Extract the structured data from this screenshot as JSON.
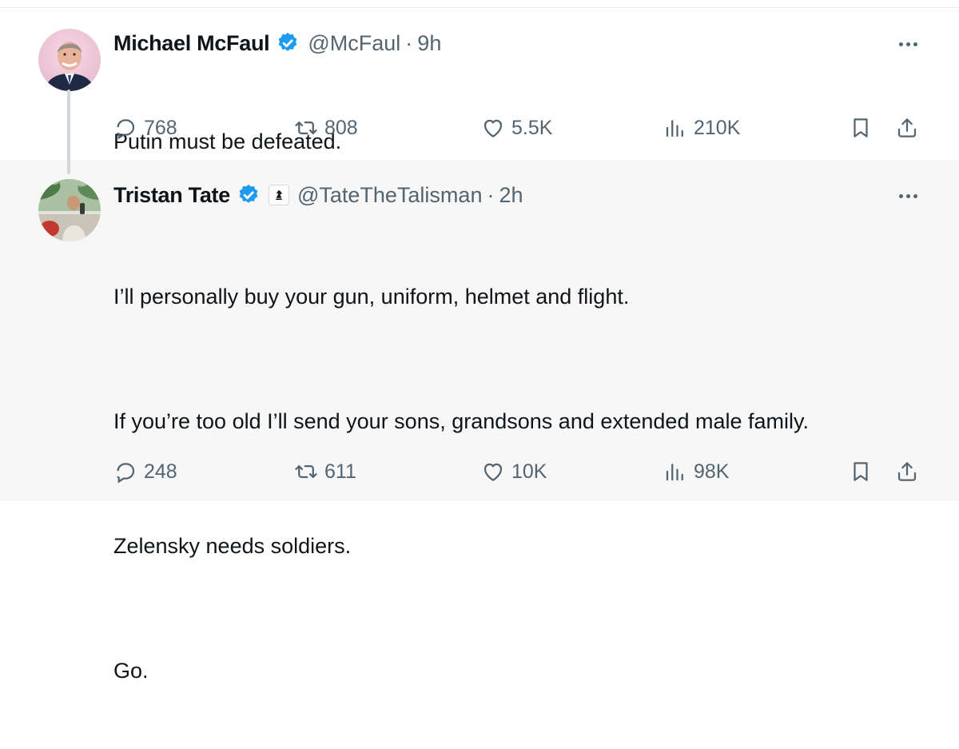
{
  "tweets": [
    {
      "name": "Michael McFaul",
      "handle": "@McFaul",
      "separator": "·",
      "time": "9h",
      "text": [
        "Putin must be defeated."
      ],
      "stats": {
        "replies": "768",
        "reposts": "808",
        "likes": "5.5K",
        "views": "210K"
      }
    },
    {
      "name": "Tristan Tate",
      "handle": "@TateTheTalisman",
      "separator": "·",
      "time": "2h",
      "text": [
        "I’ll personally buy your gun, uniform, helmet and flight.",
        "If you’re too old I’ll send your sons, grandsons and extended male family.",
        "Zelensky needs soldiers.",
        "Go."
      ],
      "stats": {
        "replies": "248",
        "reposts": "611",
        "likes": "10K",
        "views": "98K"
      }
    }
  ],
  "icons": {
    "verified": "verified-badge-icon",
    "affiliation": "knight-chess-piece-icon",
    "more": "more-horizontal-icon",
    "reply": "reply-icon",
    "repost": "repost-icon",
    "like": "heart-icon",
    "views": "views-bar-chart-icon",
    "bookmark": "bookmark-icon",
    "share": "share-icon"
  },
  "colors": {
    "verified_blue": "#1d9bf0",
    "secondary_text": "#536471",
    "reply_background": "#f7f7f7",
    "thread_line": "#cfd9de"
  }
}
